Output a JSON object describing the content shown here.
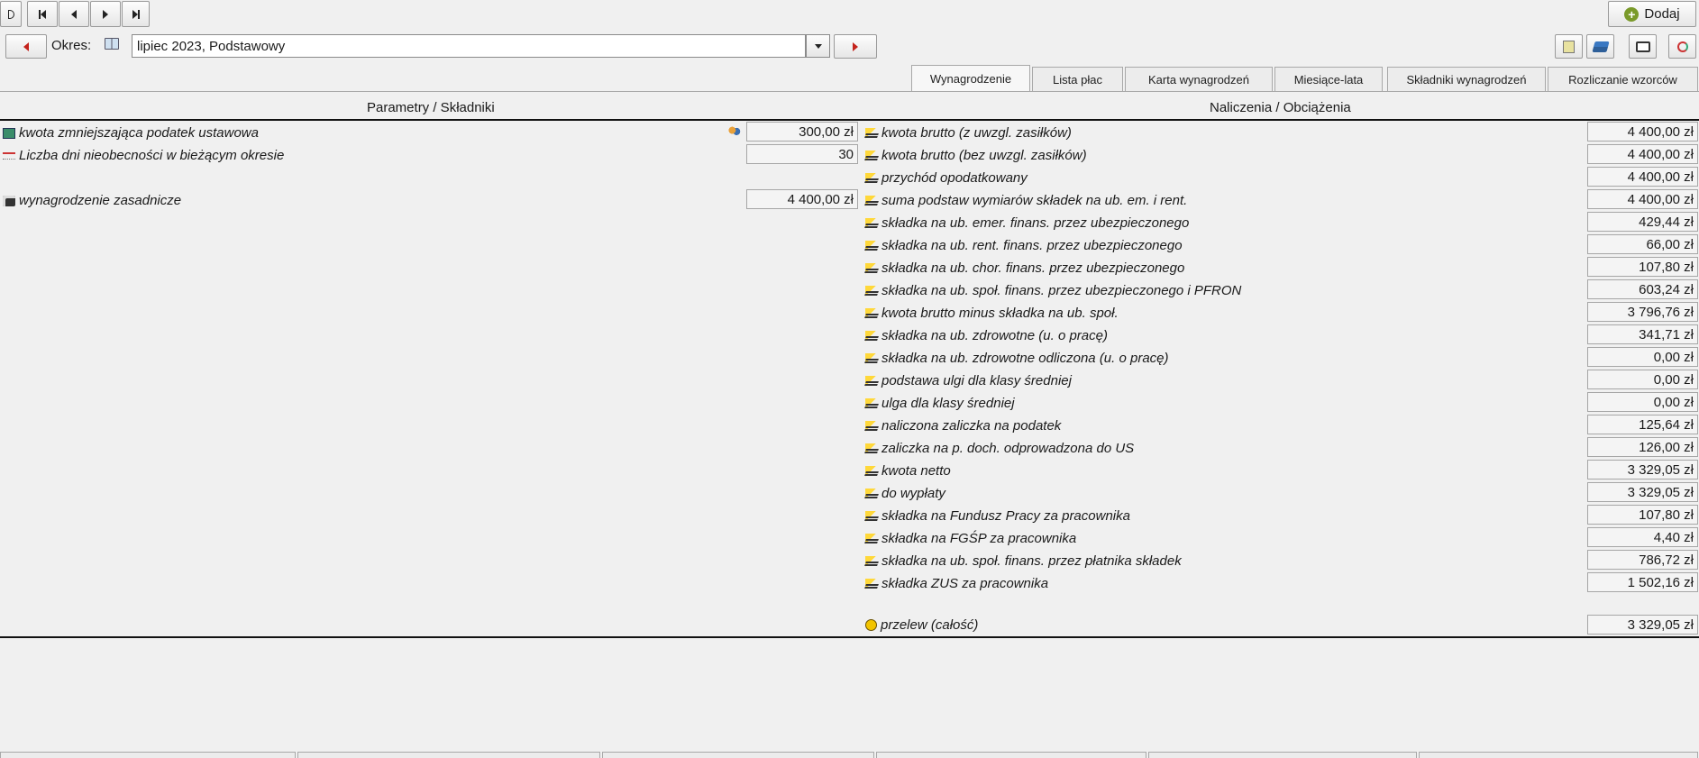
{
  "toolbar": {
    "okres_label": "Okres:",
    "okres_value": "lipiec 2023, Podstawowy",
    "add_label": "Dodaj"
  },
  "tabs": [
    {
      "label": "Wynagrodzenie"
    },
    {
      "label": "Lista płac"
    },
    {
      "label": "Karta wynagrodzeń"
    },
    {
      "label": "Miesiące-lata"
    },
    {
      "label": "Składniki wynagrodzeń"
    },
    {
      "label": "Rozliczanie wzorców"
    }
  ],
  "left": {
    "header": "Parametry / Składniki",
    "rows": [
      {
        "label": "kwota zmniejszająca podatek ustawowa",
        "value": "300,00 zł",
        "icon": "document-icon"
      },
      {
        "label": "Liczba dni nieobecności w bieżącym okresie",
        "value": "30",
        "icon": "calendar-icon"
      },
      {
        "label": "wynagrodzenie zasadnicze",
        "value": "4 400,00 zł",
        "icon": "salary-icon"
      }
    ]
  },
  "right": {
    "header": "Naliczenia / Obciążenia",
    "rows": [
      {
        "label": "kwota brutto (z uwzgl. zasiłków)",
        "value": "4 400,00 zł"
      },
      {
        "label": "kwota brutto (bez uwzgl. zasiłków)",
        "value": "4 400,00 zł"
      },
      {
        "label": "przychód opodatkowany",
        "value": "4 400,00 zł"
      },
      {
        "label": "suma podstaw wymiarów składek na ub. em. i rent.",
        "value": "4 400,00 zł"
      },
      {
        "label": "składka na ub. emer. finans. przez ubezpieczonego",
        "value": "429,44 zł"
      },
      {
        "label": "składka na ub. rent. finans. przez ubezpieczonego",
        "value": "66,00 zł"
      },
      {
        "label": "składka na ub. chor. finans. przez ubezpieczonego",
        "value": "107,80 zł"
      },
      {
        "label": "składka na ub. społ. finans. przez ubezpieczonego i PFRON",
        "value": "603,24 zł"
      },
      {
        "label": "kwota brutto minus składka na ub. społ.",
        "value": "3 796,76 zł"
      },
      {
        "label": "składka na ub. zdrowotne (u. o pracę)",
        "value": "341,71 zł"
      },
      {
        "label": "składka na ub. zdrowotne odliczona (u. o pracę)",
        "value": "0,00 zł"
      },
      {
        "label": "podstawa ulgi dla klasy średniej",
        "value": "0,00 zł"
      },
      {
        "label": "ulga dla klasy średniej",
        "value": "0,00 zł"
      },
      {
        "label": "naliczona zaliczka na podatek",
        "value": "125,64 zł"
      },
      {
        "label": "zaliczka na p. doch. odprowadzona do US",
        "value": "126,00 zł"
      },
      {
        "label": "kwota netto",
        "value": "3 329,05 zł"
      },
      {
        "label": "do wypłaty",
        "value": "3 329,05 zł"
      },
      {
        "label": "składka na Fundusz Pracy za pracownika",
        "value": "107,80 zł"
      },
      {
        "label": "składka na FGŚP za pracownika",
        "value": "4,40 zł"
      },
      {
        "label": "składka na ub. społ. finans. przez płatnika składek",
        "value": "786,72 zł"
      },
      {
        "label": "składka ZUS za pracownika",
        "value": "1 502,16 zł"
      }
    ],
    "transfer": {
      "label": "przelew (całość)",
      "value": "3 329,05 zł"
    }
  }
}
